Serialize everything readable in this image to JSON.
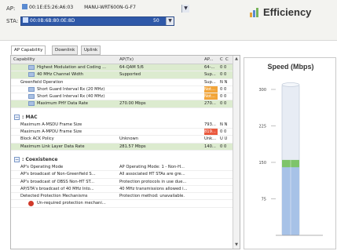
{
  "header": {
    "ap_label": "AP:",
    "ap_value": "00:1E:E5:26:A6:03",
    "ap_name": "MANU-WRT600N-G-F7",
    "sta_label": "STA:",
    "sta_value": "00:0B:6B:80:0E:8D",
    "sta_suffix": "50",
    "title": "Efficiency"
  },
  "tabs": [
    {
      "label": "AP Capability",
      "active": true
    },
    {
      "label": "Downlink",
      "active": false
    },
    {
      "label": "Uplink",
      "active": false
    }
  ],
  "table": {
    "columns": [
      "Capability",
      "AP(Tx)",
      "AP...",
      "C",
      "C"
    ],
    "rows_top": [
      {
        "cap": "Highest Modulation and Coding ...",
        "ap": "64-QAM 5/6",
        "apr": "64-...",
        "c": "0 0",
        "style": "green",
        "icon": true
      },
      {
        "cap": "40 MHz Channel Width",
        "ap": "Supported",
        "apr": "Sup...",
        "c": "0 0",
        "style": "green",
        "icon": true
      },
      {
        "cap": "Greenfield Operation",
        "ap": "",
        "apr": "Sup...",
        "c": "N N",
        "style": "",
        "icon": false
      },
      {
        "cap": "Short Guard Interval Rx (20 MHz)",
        "ap": "",
        "apr": "Not...",
        "c": "0 0",
        "style": "orange",
        "icon": true
      },
      {
        "cap": "Short Guard Interval Rx (40 MHz)",
        "ap": "",
        "apr": "Not...",
        "c": "0 0",
        "style": "orange",
        "icon": true
      },
      {
        "cap": "Maximum PHY Data Rate",
        "ap": "270.00 Mbps",
        "apr": "270...",
        "c": "0 0",
        "style": "green",
        "icon": true
      }
    ],
    "section_mac": ": MAC",
    "rows_mac": [
      {
        "cap": "Maximum A-MSDU Frame Size",
        "ap": "",
        "apr": "793...",
        "c": "N N",
        "style": "",
        "icon": false
      },
      {
        "cap": "Maximum A-MPDU Frame Size",
        "ap": "",
        "apr": "819...",
        "c": "0 0",
        "style": "red",
        "icon": false
      },
      {
        "cap": "Block ACK Policy",
        "ap": "Unknown",
        "apr": "Unk...",
        "c": "U U",
        "style": "",
        "icon": false
      },
      {
        "cap": "Maximum Link Layer Data Rate",
        "ap": "281.57 Mbps",
        "apr": "140...",
        "c": "0 0",
        "style": "green",
        "icon": false
      }
    ],
    "section_coex": ": Coexistence",
    "rows_coex": [
      {
        "cap": "AP's Operating Mode",
        "ap": "AP Operating Mode: 1 - Non-H...",
        "apr": "",
        "c": "",
        "style": "",
        "icon": false
      },
      {
        "cap": "AP's broadcast of Non-Greenfield S...",
        "ap": "All associated HT STAs are gre...",
        "apr": "",
        "c": "",
        "style": "",
        "icon": false
      },
      {
        "cap": "AP's broadcast of OBSS Non-HT ST...",
        "ap": "Protection protocols in use due...",
        "apr": "",
        "c": "",
        "style": "",
        "icon": false
      },
      {
        "cap": "AP/STA's broadcast of 40 MHz Into...",
        "ap": "40 MHz transmissions allowed i...",
        "apr": "",
        "c": "",
        "style": "",
        "icon": false
      },
      {
        "cap": "Detected Protection Mechanisms",
        "ap": "Protection method: unavailable.",
        "apr": "",
        "c": "",
        "style": "",
        "icon": false
      },
      {
        "cap": "Un-required protection mechani...",
        "ap": "",
        "apr": "",
        "c": "",
        "style": "warn",
        "icon": false
      }
    ]
  },
  "speed_panel": {
    "title": "Speed (Mbps)",
    "ticks": [
      "300",
      "225",
      "150",
      "75"
    ],
    "bar_blue_value": 140,
    "bar_green_value": 155,
    "bar_max": 300,
    "colors": {
      "tube": "#e7ecf4",
      "blue": "#a7c2e7",
      "green": "#7ec46a",
      "axis": "#999999"
    }
  },
  "colors": {
    "green_row": "#dcebcf",
    "orange_cell": "#f2a53a",
    "red_cell": "#ea5a3f",
    "selected": "#2e58a8"
  }
}
